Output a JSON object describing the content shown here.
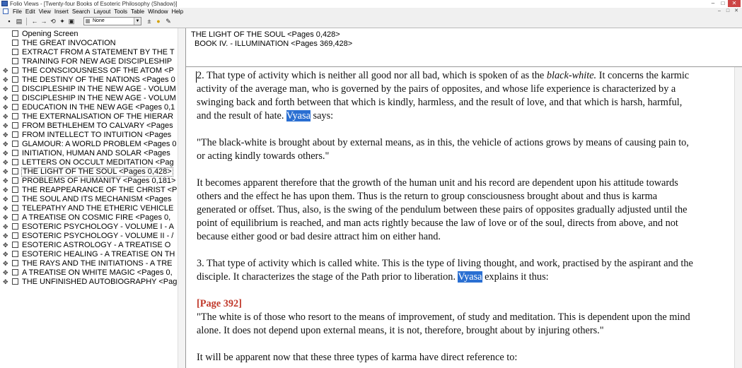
{
  "window": {
    "title": "Folio Views - [Twenty-four Books of Esoteric Philosophy (Shadow)]",
    "controls": [
      "–",
      "□",
      "✕"
    ]
  },
  "menu": [
    "File",
    "Edit",
    "View",
    "Insert",
    "Search",
    "Layout",
    "Tools",
    "Table",
    "Window",
    "Help"
  ],
  "toolbar": {
    "style_value": "None"
  },
  "tree": [
    {
      "label": "Opening Screen",
      "expandable": false
    },
    {
      "label": "THE GREAT INVOCATION",
      "expandable": false
    },
    {
      "label": "EXTRACT FROM A STATEMENT BY THE T",
      "expandable": false
    },
    {
      "label": "TRAINING FOR NEW AGE DISCIPLESHIP",
      "expandable": false
    },
    {
      "label": "THE CONSCIOUSNESS OF THE ATOM <P",
      "expandable": true
    },
    {
      "label": "THE DESTINY OF THE NATIONS <Pages 0",
      "expandable": true
    },
    {
      "label": "DISCIPLESHIP IN THE NEW AGE - VOLUM",
      "expandable": true
    },
    {
      "label": "DISCIPLESHIP IN THE NEW AGE - VOLUM",
      "expandable": true
    },
    {
      "label": "EDUCATION IN THE NEW AGE <Pages 0,1",
      "expandable": true
    },
    {
      "label": "THE EXTERNALISATION OF THE HIERAR",
      "expandable": true
    },
    {
      "label": "FROM BETHLEHEM TO CALVARY <Pages",
      "expandable": true
    },
    {
      "label": "FROM INTELLECT TO INTUITION <Pages",
      "expandable": true
    },
    {
      "label": "GLAMOUR: A WORLD PROBLEM <Pages 0",
      "expandable": true
    },
    {
      "label": "INITIATION, HUMAN AND SOLAR <Pages",
      "expandable": true
    },
    {
      "label": "LETTERS ON OCCULT MEDITATION <Pag",
      "expandable": true
    },
    {
      "label": "THE LIGHT OF THE SOUL <Pages 0,428>",
      "expandable": true,
      "selected": true
    },
    {
      "label": "PROBLEMS OF HUMANITY <Pages 0,181>",
      "expandable": true
    },
    {
      "label": "THE REAPPEARANCE OF THE CHRIST <P",
      "expandable": true
    },
    {
      "label": "THE SOUL AND ITS MECHANISM <Pages",
      "expandable": true
    },
    {
      "label": "TELEPATHY AND THE ETHERIC VEHICLE",
      "expandable": true
    },
    {
      "label": "A TREATISE ON COSMIC FIRE <Pages 0,",
      "expandable": true
    },
    {
      "label": "ESOTERIC PSYCHOLOGY - VOLUME I - A",
      "expandable": true
    },
    {
      "label": "ESOTERIC PSYCHOLOGY - VOLUME II - /",
      "expandable": true
    },
    {
      "label": "ESOTERIC ASTROLOGY - A TREATISE O",
      "expandable": true
    },
    {
      "label": "ESOTERIC HEALING - A TREATISE ON TH",
      "expandable": true
    },
    {
      "label": "THE RAYS AND THE INITIATIONS - A TRE",
      "expandable": true
    },
    {
      "label": "A TREATISE ON WHITE MAGIC <Pages 0,",
      "expandable": true
    },
    {
      "label": "THE UNFINISHED AUTOBIOGRAPHY <Pag",
      "expandable": true
    }
  ],
  "header": {
    "line1": "THE LIGHT OF THE SOUL <Pages 0,428>",
    "line2": "BOOK IV. - ILLUMINATION <Pages 369,428>"
  },
  "doc": {
    "p1": {
      "l1_a": "2. That type of activity which is neither all good nor all bad, which is spoken of as the ",
      "l1_em": "black-white.",
      "l1_b": "  It concerns the karmic",
      "l2": "activity of the average man, who is governed by the pairs of opposites, and whose life experience is characterized by a",
      "l3": "swinging back and forth between that which is kindly, harmless, and the result of love, and that which is harsh, harmful,",
      "l4_a": "and the result of hate.  ",
      "l4_hl": "Vyasa",
      "l4_b": " says:"
    },
    "p2": {
      "l1": "\"The black-white is brought about by external means, as in this, the vehicle of actions grows by means of causing pain to,",
      "l2": "or acting kindly towards others.\""
    },
    "p3": {
      "l1": "It becomes apparent therefore that the growth of the human unit and his record are dependent upon his attitude towards",
      "l2": "others and the effect he has upon them.  Thus is the return to group consciousness brought about and thus is karma",
      "l3": "generated or offset.  Thus, also, is the swing of the pendulum between these pairs of opposites gradually adjusted until the",
      "l4": "point of equilibrium is reached, and man acts rightly because the law of love or of the soul, directs from above, and not",
      "l5": "because either good or bad desire attract him on either hand."
    },
    "p4": {
      "l1": "3. That type of activity which is called white.  This is the type of living thought, and work, practised by the aspirant and the",
      "l2_a": "disciple.  It characterizes the stage of the Path prior to liberation.  ",
      "l2_hl": "Vyasa",
      "l2_b": " explains it thus:"
    },
    "page_ref": "[Page 392]",
    "p5": {
      "l1": "\"The white is of those who resort to the means of improvement, of study and meditation.  This is dependent upon the mind",
      "l2": "alone.  It does not depend upon external means, it is not, therefore, brought about by injuring others.\""
    },
    "p6": {
      "l1": "It will be apparent now that these three types of karma have direct reference to:"
    }
  }
}
